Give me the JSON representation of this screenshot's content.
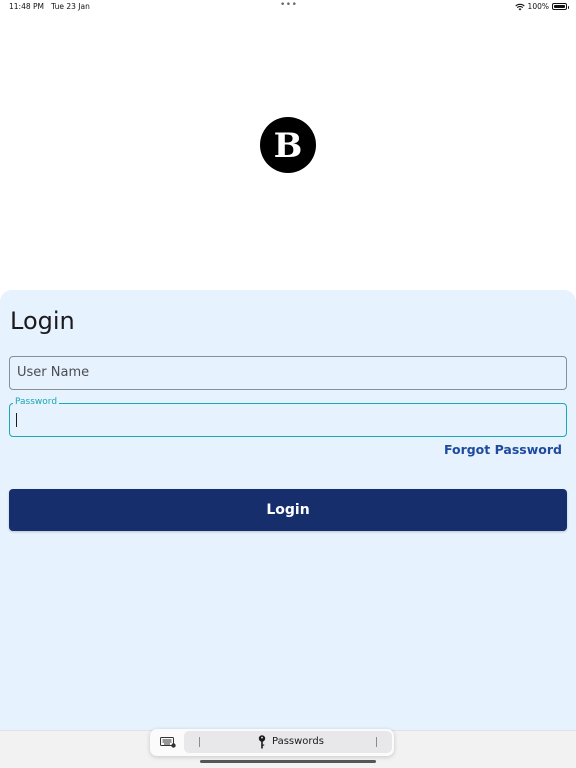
{
  "status_bar": {
    "time": "11:48 PM",
    "date": "Tue 23 Jan",
    "dots": "•••",
    "battery": "100%",
    "icons": [
      "wifi-icon",
      "battery-icon"
    ]
  },
  "logo": {
    "letter": "B",
    "color": "#000000"
  },
  "login": {
    "title": "Login",
    "username_placeholder": "User Name",
    "password_label": "Password",
    "forgot_password": "Forgot Password",
    "button_label": "Login"
  },
  "keyboard_bar": {
    "passwords_label": "Passwords",
    "icons": [
      "keyboard-icon",
      "key-icon"
    ]
  },
  "colors": {
    "panel_bg": "#e6f2fd",
    "accent": "#1aa6b7",
    "button_bg": "#172e6d",
    "link": "#1e4b9e"
  }
}
